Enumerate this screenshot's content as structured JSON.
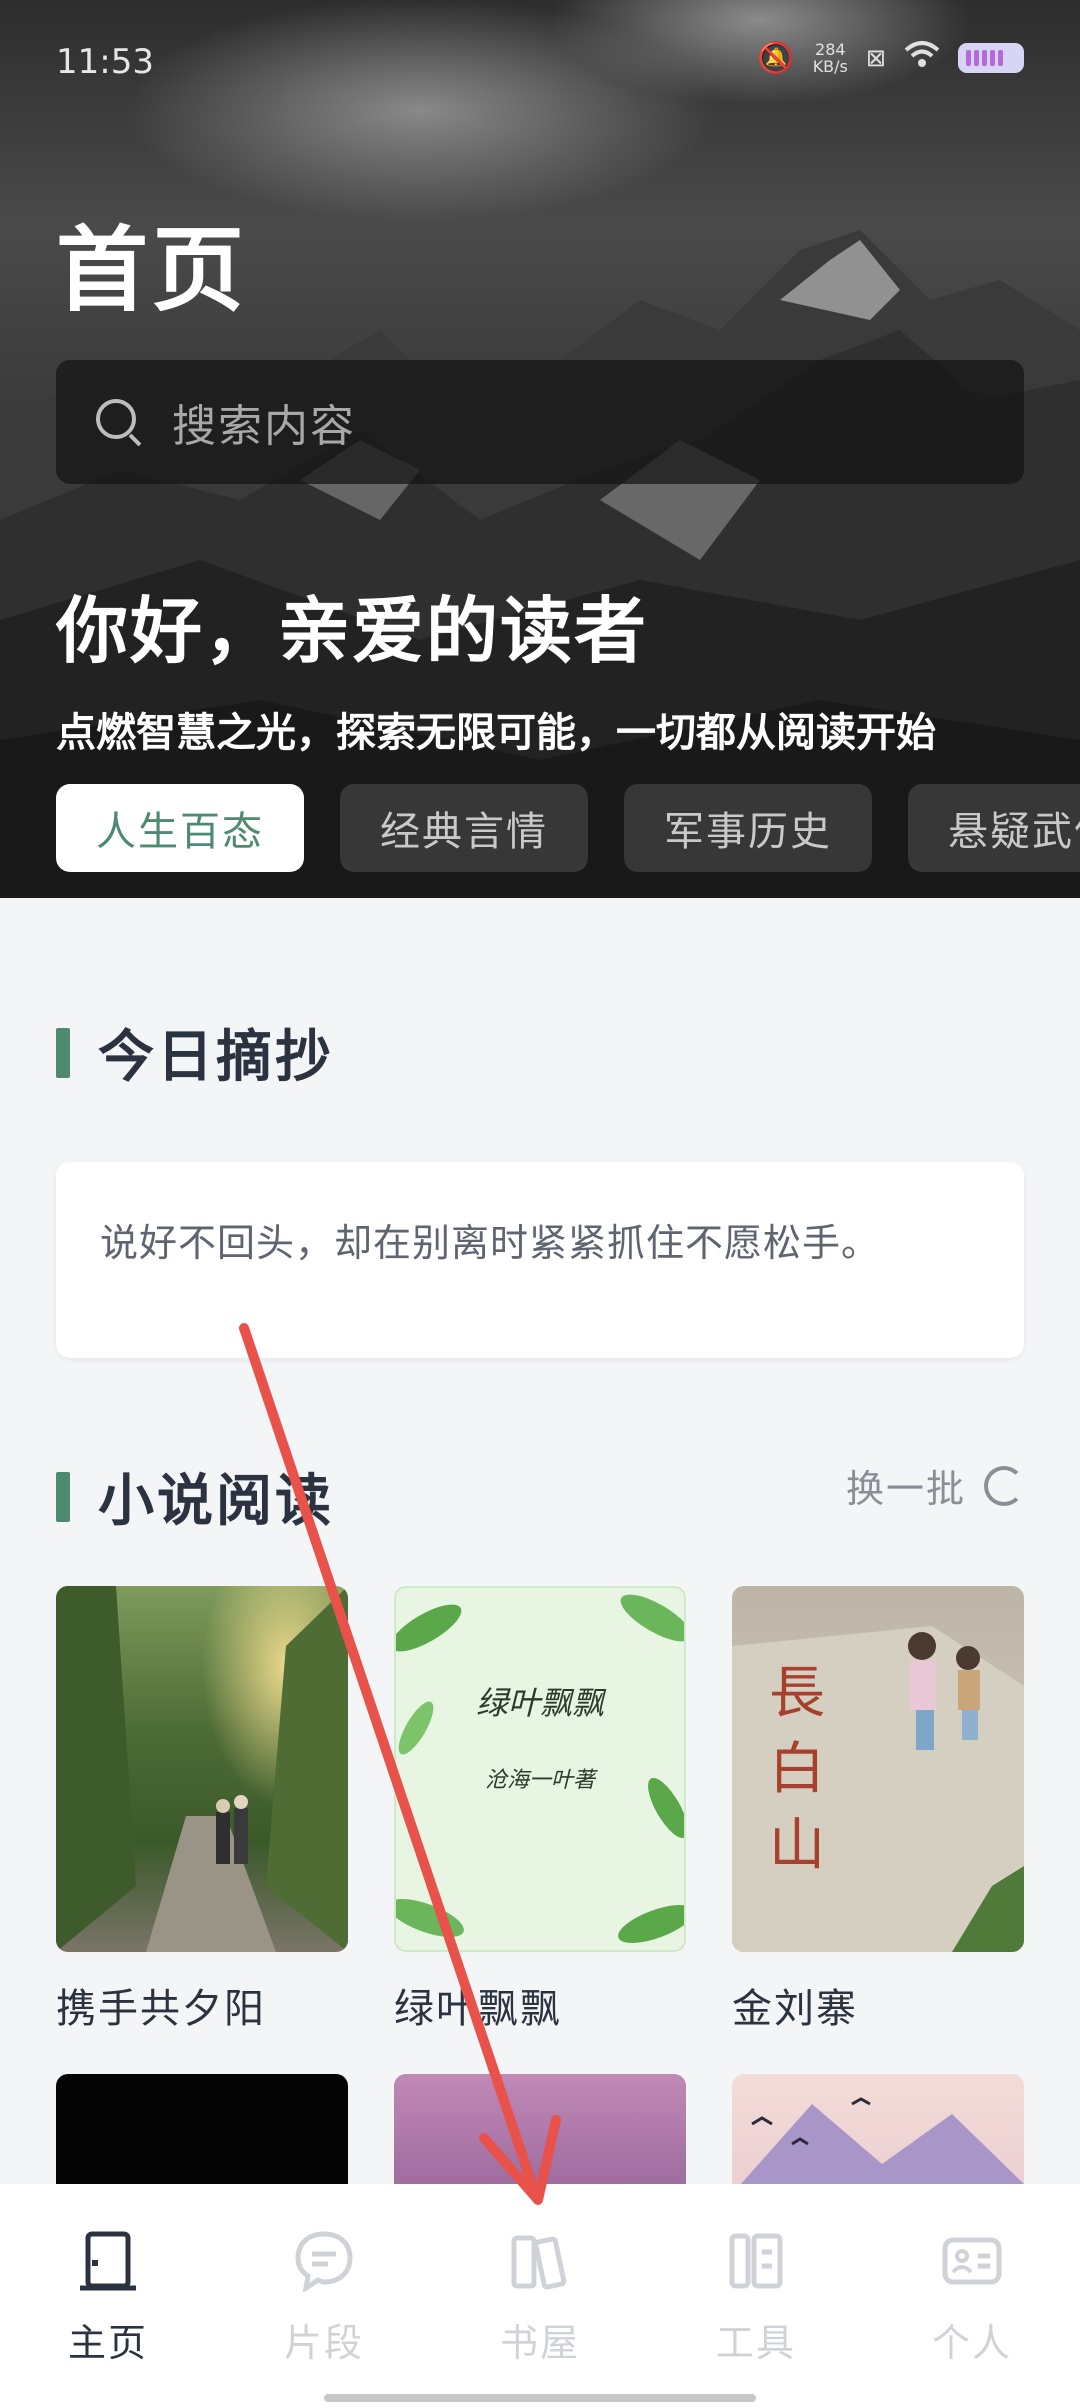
{
  "status_bar": {
    "time": "11:53",
    "net_speed_value": "284",
    "net_speed_unit": "KB/s"
  },
  "header": {
    "title": "首页"
  },
  "search": {
    "placeholder": "搜索内容"
  },
  "greeting": {
    "title": "你好，亲爱的读者",
    "tagline": "点燃智慧之光，探索无限可能，一切都从阅读开始"
  },
  "category_tabs": [
    {
      "label": "人生百态",
      "active": true
    },
    {
      "label": "经典言情",
      "active": false
    },
    {
      "label": "军事历史",
      "active": false
    },
    {
      "label": "悬疑武侠",
      "active": false
    }
  ],
  "daily_excerpt": {
    "title": "今日摘抄",
    "text": "说好不回头，却在别离时紧紧抓住不愿松手。"
  },
  "novel_reading": {
    "title": "小说阅读",
    "refresh_label": "换一批",
    "books": [
      {
        "title": "携手共夕阳"
      },
      {
        "title": "绿叶飘飘",
        "cover_title": "绿叶飘飘",
        "cover_author": "沧海一叶著"
      },
      {
        "title": "金刘寨",
        "cover_text": "長白山"
      },
      {
        "title": ""
      },
      {
        "title": ""
      },
      {
        "title": ""
      }
    ]
  },
  "bottom_nav": [
    {
      "label": "主页",
      "icon": "door-icon",
      "active": true
    },
    {
      "label": "片段",
      "icon": "chat-bubble-icon",
      "active": false
    },
    {
      "label": "书屋",
      "icon": "books-icon",
      "active": false
    },
    {
      "label": "工具",
      "icon": "tools-icon",
      "active": false
    },
    {
      "label": "个人",
      "icon": "id-card-icon",
      "active": false
    }
  ],
  "colors": {
    "accent": "#4e8a6f",
    "arrow": "#e8524a",
    "text_dark": "#2b3340"
  }
}
